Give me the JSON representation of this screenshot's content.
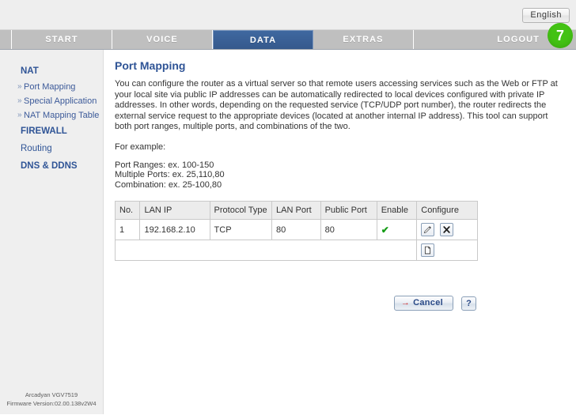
{
  "header": {
    "language_button": "English"
  },
  "nav": {
    "tabs": [
      {
        "label": "START",
        "active": false
      },
      {
        "label": "VOICE",
        "active": false
      },
      {
        "label": "DATA",
        "active": true
      },
      {
        "label": "EXTRAS",
        "active": false
      }
    ],
    "logout_label": "LOGOUT",
    "badge": "7",
    "badge_color": "#43c214",
    "active_tab_color": "#3a5f95"
  },
  "sidebar": {
    "groups": [
      {
        "label": "NAT",
        "bold": true,
        "items": [
          {
            "label": "Port Mapping"
          },
          {
            "label": "Special Application"
          },
          {
            "label": "NAT Mapping Table"
          }
        ]
      },
      {
        "label": "FIREWALL",
        "bold": true,
        "items": []
      },
      {
        "label": "Routing",
        "bold": false,
        "items": []
      },
      {
        "label": "DNS & DDNS",
        "bold": true,
        "items": []
      }
    ],
    "chevron": "»"
  },
  "footer": {
    "model": "Arcadyan VGV7519",
    "firmware": "Firmware Version:02.00.138v2W4"
  },
  "main": {
    "title": "Port Mapping",
    "description": "You can configure the router as a virtual server so that remote users accessing services such as the Web or FTP at your local site via public IP addresses can be automatically redirected to local devices configured with private IP addresses. In other words, depending on the requested service (TCP/UDP port number), the router redirects the external service request to the appropriate devices (located at another internal IP address). This tool can support both port ranges, multiple ports, and combinations of the two.",
    "example_label": "For example:",
    "example_lines": [
      "Port Ranges: ex. 100-150",
      "Multiple Ports: ex. 25,110,80",
      "Combination: ex. 25-100,80"
    ],
    "table": {
      "columns": [
        "No.",
        "LAN IP",
        "Protocol Type",
        "LAN Port",
        "Public Port",
        "Enable",
        "Configure"
      ],
      "rows": [
        {
          "no": "1",
          "lan_ip": "192.168.2.10",
          "protocol": "TCP",
          "lan_port": "80",
          "public_port": "80",
          "enable": "✔",
          "enable_color": "#159c16"
        }
      ]
    },
    "buttons": {
      "cancel_arrow": "→",
      "cancel_label": "Cancel",
      "help_label": "?"
    }
  }
}
